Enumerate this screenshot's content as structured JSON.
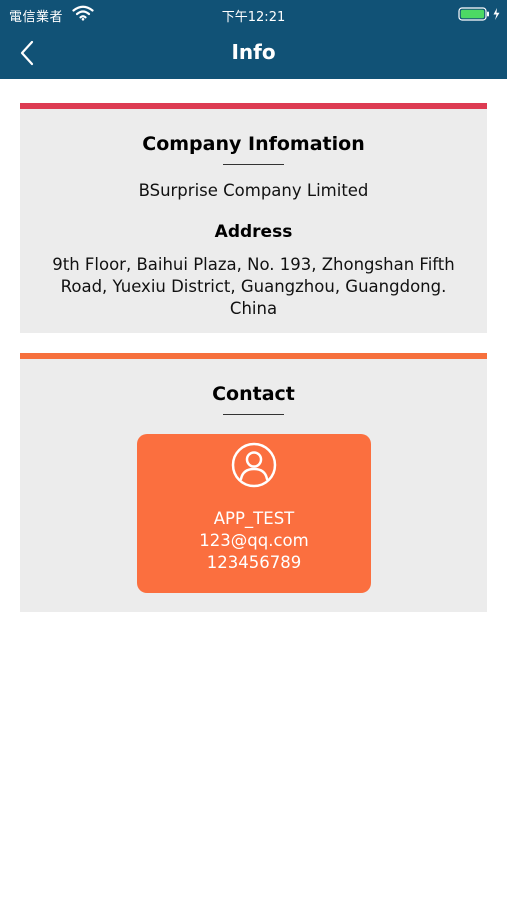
{
  "status_bar": {
    "carrier": "電信業者",
    "time": "下午12:21"
  },
  "nav": {
    "title": "Info",
    "back_icon": "chevron-left-icon"
  },
  "company_section": {
    "title": "Company Infomation",
    "company_name": "BSurprise Company Limited",
    "address_heading": "Address",
    "address": "9th Floor, Baihui Plaza, No. 193, Zhongshan Fifth Road, Yuexiu District, Guangzhou, Guangdong. China",
    "accent_color": "#dd3b52"
  },
  "contact_section": {
    "title": "Contact",
    "accent_color": "#f6703d",
    "contact": {
      "icon": "user-circle-icon",
      "name": "APP_TEST",
      "email": "123@qq.com",
      "phone": "123456789",
      "tile_color": "#fb6f3f"
    }
  },
  "colors": {
    "header_bg": "#115276",
    "card_bg": "#ececec"
  }
}
